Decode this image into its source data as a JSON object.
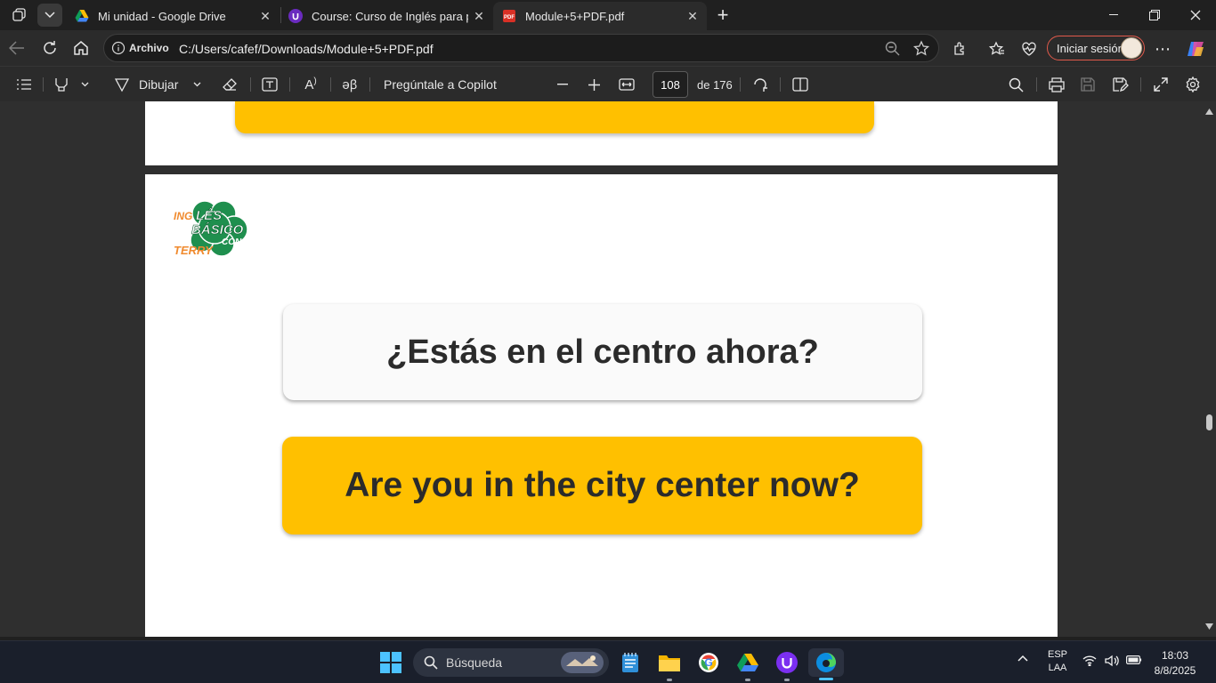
{
  "browser": {
    "tabs": [
      {
        "title": "Mi unidad - Google Drive",
        "icon": "google-drive-icon",
        "active": false
      },
      {
        "title": "Course: Curso de Inglés para principiantes",
        "icon": "course-icon",
        "active": false
      },
      {
        "title": "Module+5+PDF.pdf",
        "icon": "pdf-icon",
        "active": true
      }
    ],
    "address": {
      "scheme_label": "Archivo",
      "url": "C:/Users/cafef/Downloads/Module+5+PDF.pdf"
    },
    "signin_label": "Iniciar sesión"
  },
  "pdf_toolbar": {
    "draw_label": "Dibujar",
    "copilot_label": "Pregúntale a Copilot",
    "current_page": "108",
    "total_pages_label": "de 176"
  },
  "document": {
    "logo_text": [
      "INGLÉS",
      "BÁSICO",
      "CON",
      "TERRY"
    ],
    "spanish_sentence": "¿Estás en el centro ahora?",
    "english_sentence": "Are you in the city center now?"
  },
  "taskbar": {
    "search_placeholder": "Búsqueda",
    "language": "ESP",
    "keyboard_layout": "LAA",
    "time": "18:03",
    "date": "8/8/2025"
  },
  "colors": {
    "accent_yellow": "#ffc000",
    "logo_green": "#1f8f4e",
    "logo_orange": "#f08a2e"
  }
}
